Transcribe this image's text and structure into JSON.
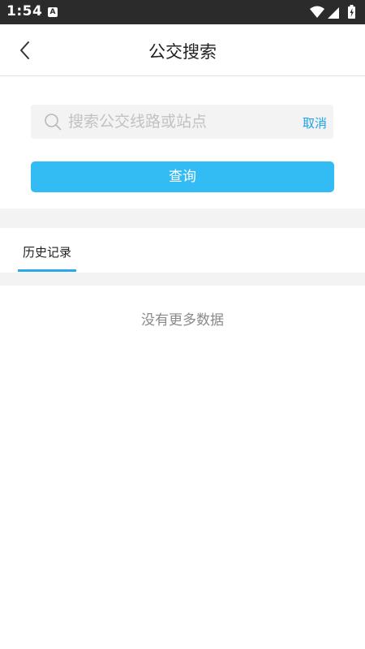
{
  "status_bar": {
    "time": "1:54",
    "notification_icon": "A",
    "icons": [
      "wifi-icon",
      "signal-icon",
      "battery-charging-icon"
    ]
  },
  "header": {
    "back_icon": "chevron-left-icon",
    "title": "公交搜索"
  },
  "search": {
    "icon": "search-icon",
    "placeholder": "搜索公交线路或站点",
    "value": "",
    "cancel_label": "取消"
  },
  "query_button": {
    "label": "查询"
  },
  "tabs": [
    {
      "label": "历史记录",
      "active": true
    }
  ],
  "history": {
    "empty_text": "没有更多数据"
  },
  "colors": {
    "status_bar_bg": "#2b2b2b",
    "accent": "#33bbf3",
    "cancel_text": "#1aa3e8",
    "section_gap": "#f3f3f3"
  }
}
